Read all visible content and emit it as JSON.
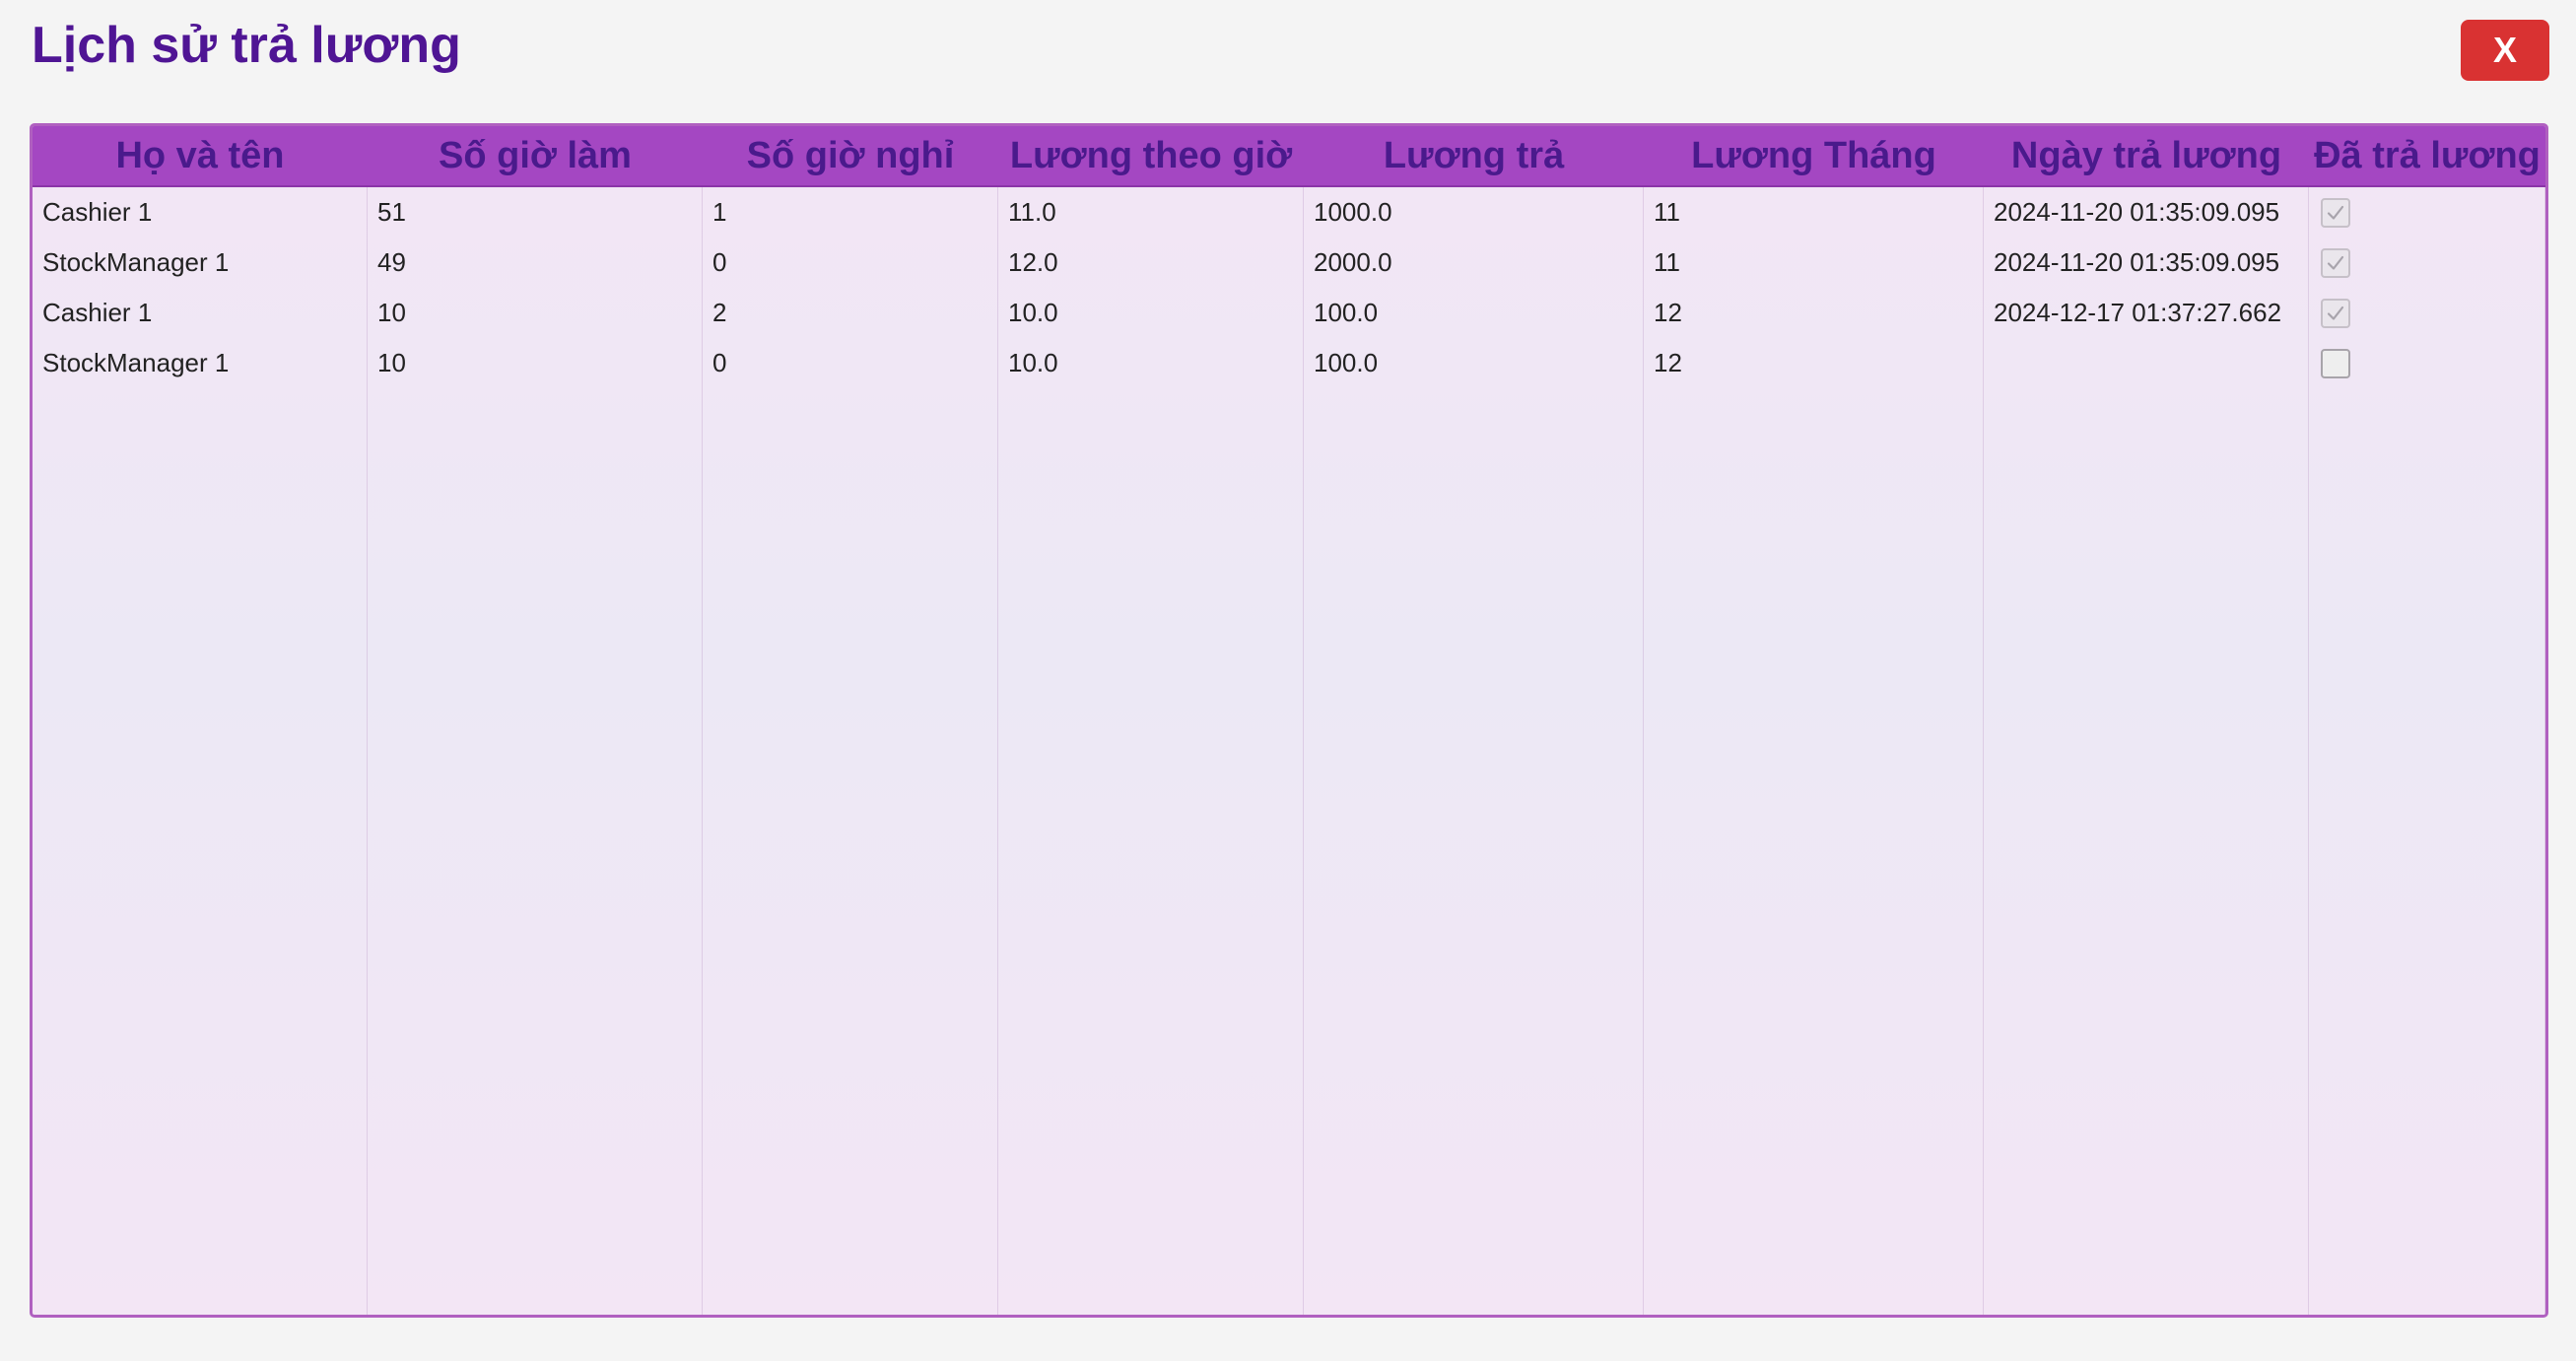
{
  "window": {
    "title": "Lịch sử trả lương",
    "close_label": "X"
  },
  "table": {
    "columns": [
      "Họ và tên",
      "Số giờ làm",
      "Số giờ nghỉ",
      "Lương theo giờ",
      "Lương trả",
      "Lương Tháng",
      "Ngày trả lương",
      "Đã trả lương"
    ],
    "rows": [
      {
        "name": "Cashier 1",
        "hours_worked": "51",
        "hours_off": "1",
        "hourly_wage": "11.0",
        "paid_wage": "1000.0",
        "month": "11",
        "pay_date": "2024-11-20 01:35:09.095",
        "paid": true
      },
      {
        "name": "StockManager 1",
        "hours_worked": "49",
        "hours_off": "0",
        "hourly_wage": "12.0",
        "paid_wage": "2000.0",
        "month": "11",
        "pay_date": "2024-11-20 01:35:09.095",
        "paid": true
      },
      {
        "name": "Cashier 1",
        "hours_worked": "10",
        "hours_off": "2",
        "hourly_wage": "10.0",
        "paid_wage": "100.0",
        "month": "12",
        "pay_date": "2024-12-17 01:37:27.662",
        "paid": true
      },
      {
        "name": "StockManager 1",
        "hours_worked": "10",
        "hours_off": "0",
        "hourly_wage": "10.0",
        "paid_wage": "100.0",
        "month": "12",
        "pay_date": "",
        "paid": false
      }
    ]
  },
  "colors": {
    "title": "#4f1594",
    "header_bg": "#a447c2",
    "header_text": "#4a1a8c",
    "close_bg": "#d93232"
  },
  "icons": {
    "close": "close-icon",
    "check": "checkmark-icon"
  }
}
